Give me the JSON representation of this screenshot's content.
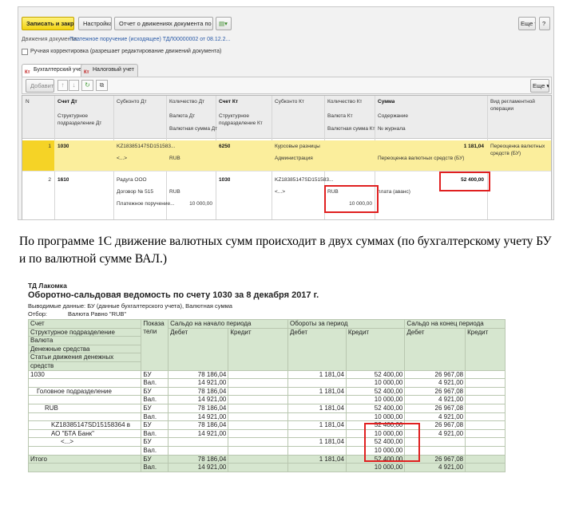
{
  "window": {
    "btn_save_close": "Записать и закрыть",
    "btn_settings": "Настройка...",
    "btn_report": "Отчет о движениях документа по регистрам",
    "btn_more": "Еще ▾",
    "btn_help": "?",
    "doc_label": "Движения документа:",
    "doc_link": "Платежное поручение (исходящее) ТДЛ00000002 от 08.12.2...",
    "manual_label": "Ручная корректировка (разрешает редактирование движений документа)",
    "tab_accounting": "Бухгалтерский учет",
    "tab_tax": "Налоговый учет",
    "tab_marker": "Кт",
    "btn_add": "Добавить",
    "btn_more2": "Еще ▾"
  },
  "grid": {
    "headers": {
      "n": "N",
      "debit_account": "Счет Дт",
      "subaccount_dt": "Субконто Дт",
      "qty_dt": "Количество Дт",
      "credit_account": "Счет Кт",
      "subaccount_kt": "Субконто Кт",
      "qty_kt": "Количество Кт",
      "amount": "Сумма",
      "op_type": "Вид регламентной",
      "op_type2": "операции",
      "struct_dt": "Структурное",
      "struct_dt2": "подразделение Дт",
      "currency_dt": "Валюта Дт",
      "cur_amount_dt": "Валютная сумма Дт",
      "struct_kt": "Структурное",
      "struct_kt2": "подразделение Кт",
      "currency_kt": "Валюта Кт",
      "cur_amount_kt": "Валютная сумма Кт",
      "content": "Содержание",
      "journal": "№ журнала"
    },
    "rows": [
      {
        "n": "1",
        "debit": "1030",
        "sub_dt_1": "KZ18385147SD151583...",
        "sub_dt_2": "<...>",
        "currency_dt": "RUB",
        "credit": "6250",
        "sub_kt_1": "Курсовые разницы",
        "sub_kt_2": "Администрация",
        "amount": "1 181,04",
        "content": "Переоценка валютных средств (БУ)",
        "op_type_1": "Переоценка валютных",
        "op_type_2": "средств (БУ)"
      },
      {
        "n": "2",
        "debit": "1610",
        "sub_dt_1": "Радуга ООО",
        "sub_dt_2": "Договор № 515",
        "sub_dt_3": "Платежное поручение...",
        "currency_dt": "RUB",
        "cur_amount_dt": "10 000,00",
        "credit": "1030",
        "sub_kt_1": "KZ18385147SD151583...",
        "sub_kt_2": "<...>",
        "currency_kt": "RUB",
        "cur_amount_kt": "10 000,00",
        "amount": "52 400,00",
        "content": "плата (аванс)"
      }
    ]
  },
  "paragraph": "По программе 1С движение валютных сумм происходит в двух суммах (по бухгалтерскому учету БУ и по валютной сумме ВАЛ.)",
  "report": {
    "org": "ТД Лакомка",
    "title": "Оборотно-сальдовая ведомость по счету 1030  за 8 декабря 2017 г.",
    "output": "Выводимые данные:  БУ (данные бухгалтерского учета), Валютная сумма",
    "filter_label": "Отбор:",
    "filter_value": "Валюта Равно \"RUB\"",
    "headers": {
      "account": "Счет",
      "indicators": "Показа",
      "indicators2": "тели",
      "opening": "Сальдо на начало периода",
      "turnover": "Обороты за период",
      "closing": "Сальдо на конец периода",
      "debit": "Дебет",
      "credit": "Кредит",
      "struct": "Структурное подразделение",
      "currency": "Валюта",
      "cash": "Денежные средства",
      "cashflow": "Статьи движения денежных",
      "cashflow2": "средств"
    },
    "rows": [
      {
        "label": "1030",
        "ind": "БУ",
        "od": "78 186,04",
        "oc": "",
        "td": "1 181,04",
        "tc": "52 400,00",
        "cd": "26 967,08",
        "cc": "",
        "level": 0
      },
      {
        "label": "",
        "ind": "Вал.",
        "od": "14 921,00",
        "oc": "",
        "td": "",
        "tc": "10 000,00",
        "cd": "4 921,00",
        "cc": "",
        "level": 0
      },
      {
        "label": "Головное подразделение",
        "ind": "БУ",
        "od": "78 186,04",
        "oc": "",
        "td": "1 181,04",
        "tc": "52 400,00",
        "cd": "26 967,08",
        "cc": "",
        "level": 1
      },
      {
        "label": "",
        "ind": "Вал.",
        "od": "14 921,00",
        "oc": "",
        "td": "",
        "tc": "10 000,00",
        "cd": "4 921,00",
        "cc": "",
        "level": 1
      },
      {
        "label": "RUB",
        "ind": "БУ",
        "od": "78 186,04",
        "oc": "",
        "td": "1 181,04",
        "tc": "52 400,00",
        "cd": "26 967,08",
        "cc": "",
        "level": 2
      },
      {
        "label": "",
        "ind": "Вал.",
        "od": "14 921,00",
        "oc": "",
        "td": "",
        "tc": "10 000,00",
        "cd": "4 921,00",
        "cc": "",
        "level": 2
      },
      {
        "label": "KZ18385147SD15158364 в",
        "ind": "БУ",
        "od": "78 186,04",
        "oc": "",
        "td": "1 181,04",
        "tc": "52 400,00",
        "cd": "26 967,08",
        "cc": "",
        "level": 3
      },
      {
        "label": "АО \"БТА Банк\"",
        "ind": "Вал.",
        "od": "14 921,00",
        "oc": "",
        "td": "",
        "tc": "10 000,00",
        "cd": "4 921,00",
        "cc": "",
        "level": 3
      },
      {
        "label": "<...>",
        "ind": "БУ",
        "od": "",
        "oc": "",
        "td": "1 181,04",
        "tc": "52 400,00",
        "cd": "",
        "cc": "",
        "level": 4
      },
      {
        "label": "",
        "ind": "Вал.",
        "od": "",
        "oc": "",
        "td": "",
        "tc": "10 000,00",
        "cd": "",
        "cc": "",
        "level": 4
      },
      {
        "label": "Итого",
        "ind": "БУ",
        "od": "78 186,04",
        "oc": "",
        "td": "1 181,04",
        "tc": "52 400,00",
        "cd": "26 967,08",
        "cc": "",
        "level": 0,
        "total": true
      },
      {
        "label": "",
        "ind": "Вал.",
        "od": "14 921,00",
        "oc": "",
        "td": "",
        "tc": "10 000,00",
        "cd": "4 921,00",
        "cc": "",
        "level": 0,
        "total": true
      }
    ]
  },
  "colors": {
    "highlight_red": "#e02020",
    "selected_row": "#fbee9c",
    "report_header": "#d6e6cf",
    "primary_button": "#f2d313"
  }
}
